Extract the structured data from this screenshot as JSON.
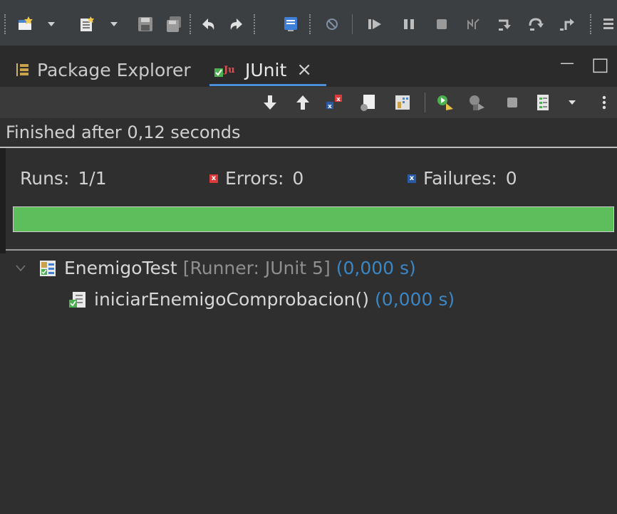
{
  "toolbar": {
    "icons": [
      "new-wizard-icon",
      "dropdown-arrow-icon",
      "new-file-icon",
      "dropdown-arrow-icon",
      "save-icon",
      "save-all-icon",
      "undo-icon",
      "redo-icon",
      "console-icon",
      "debug-icon",
      "resume-icon",
      "suspend-icon",
      "terminate-icon",
      "disconnect-icon",
      "step-into-icon",
      "step-over-icon",
      "step-return-icon"
    ]
  },
  "tabs": [
    {
      "label": "Package Explorer",
      "icon": "package-explorer-icon",
      "active": false
    },
    {
      "label": "JUnit",
      "icon": "junit-icon",
      "active": true
    }
  ],
  "view": {
    "close_glyph": "×",
    "minimize_glyph": "—",
    "maximize_glyph": "□"
  },
  "status": {
    "text": "Finished after 0,12 seconds"
  },
  "counters": {
    "runs_label": "Runs:",
    "runs_value": "1/1",
    "errors_label": "Errors:",
    "errors_value": "0",
    "failures_label": "Failures:",
    "failures_value": "0"
  },
  "progress": {
    "fraction": 1.0,
    "color": "#5cbf5c"
  },
  "tree": {
    "suite": {
      "name": "EnemigoTest",
      "runner": "[Runner: JUnit 5]",
      "time": "(0,000 s)"
    },
    "test": {
      "name": "iniciarEnemigoComprobacion()",
      "time": "(0,000 s)"
    }
  }
}
